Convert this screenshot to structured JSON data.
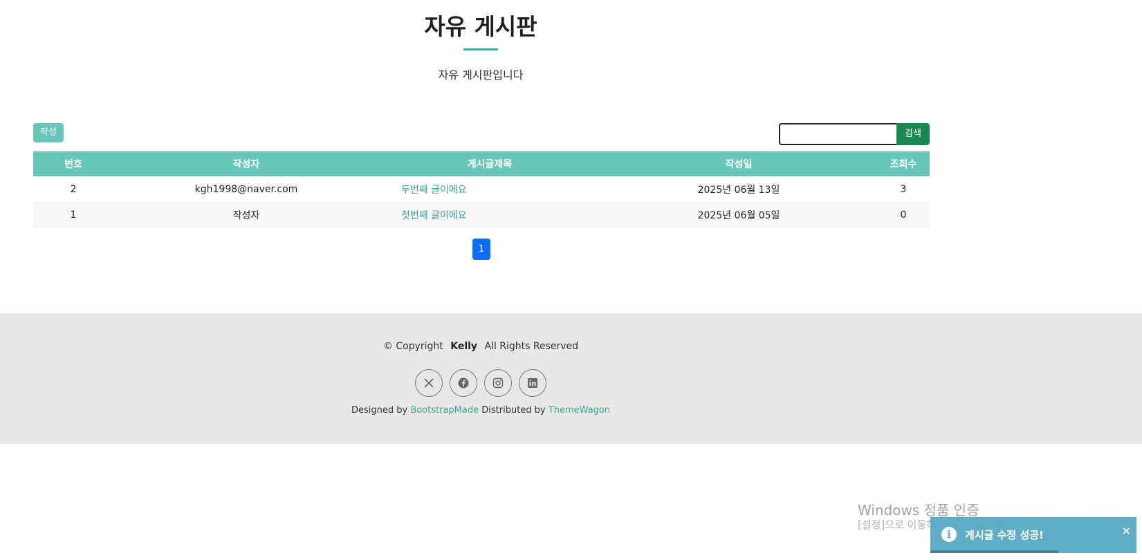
{
  "header": {
    "title": "자유 게시판",
    "subtitle": "자유 게시판입니다"
  },
  "toolbar": {
    "write_label": "작성",
    "search_placeholder": "",
    "search_label": "검색"
  },
  "table": {
    "columns": [
      "번호",
      "작성자",
      "게시글제목",
      "작성일",
      "조회수"
    ],
    "rows": [
      {
        "no": "2",
        "author": "kgh1998@naver.com",
        "title": "두번째 글이에요",
        "date": "2025년 06월 13일",
        "views": "3"
      },
      {
        "no": "1",
        "author": "작성자",
        "title": "첫번째 글이에요",
        "date": "2025년 06월 05일",
        "views": "0"
      }
    ]
  },
  "pagination": {
    "current": "1"
  },
  "footer": {
    "copyright_prefix": "© Copyright",
    "copyright_name": "Kelly",
    "copyright_suffix": "All Rights Reserved",
    "social_icons": [
      "x-icon",
      "facebook-icon",
      "instagram-icon",
      "linkedin-icon"
    ],
    "designed_by": "Designed by",
    "designed_link": "BootstrapMade",
    "distributed_by": "Distributed by",
    "distributed_link": "ThemeWagon"
  },
  "watermark": {
    "title": "Windows 정품 인증",
    "subtitle": "[설정]으로 이동하여 Windows를 정품 인증합니다."
  },
  "toast": {
    "icon": "info-icon",
    "message": "게시글 수정 성공!",
    "close": "×",
    "progress": 0.62
  },
  "colors": {
    "accent": "#36b4a0",
    "table_header": "#67c6b8",
    "search_button": "#198754",
    "page_active": "#0d6efd",
    "footer_bg": "#e9e7e5",
    "toast_bg": "#5aaac5"
  }
}
